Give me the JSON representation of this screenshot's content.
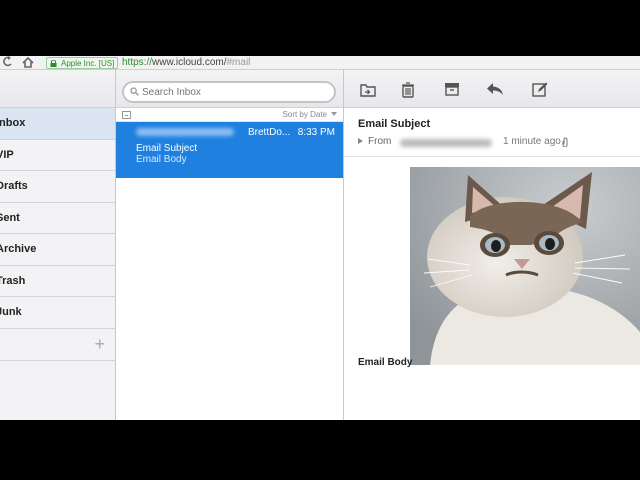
{
  "browser": {
    "secure_label": "Apple Inc. [US]",
    "url_scheme": "https://",
    "url_host": "www.icloud.com/",
    "url_fragment": "#mail"
  },
  "sidebar": {
    "folders": [
      {
        "label": "Inbox",
        "active": true
      },
      {
        "label": "VIP"
      },
      {
        "label": "Drafts"
      },
      {
        "label": "Sent"
      },
      {
        "label": "Archive"
      },
      {
        "label": "Trash"
      },
      {
        "label": "Junk"
      }
    ],
    "add_label": "+"
  },
  "list": {
    "search_placeholder": "Search Inbox",
    "sort_label": "Sort by Date",
    "messages": [
      {
        "from": "BrettDo...",
        "time": "8:33 PM",
        "subject": "Email Subject",
        "preview": "Email Body",
        "selected": true
      }
    ]
  },
  "reader": {
    "subject": "Email Subject",
    "from_label": "From",
    "time_ago": "1 minute ago",
    "body": "Email Body"
  },
  "colors": {
    "selection_blue": "#1f80e0",
    "sidebar_active": "#dbe4f1",
    "secure_green": "#2e8b2e"
  },
  "icons": [
    "back-icon",
    "home-icon",
    "lock-icon",
    "search-icon",
    "collapse-icon",
    "move-to-folder-icon",
    "trash-icon",
    "archive-icon",
    "reply-icon",
    "compose-icon",
    "paperclip-icon"
  ]
}
